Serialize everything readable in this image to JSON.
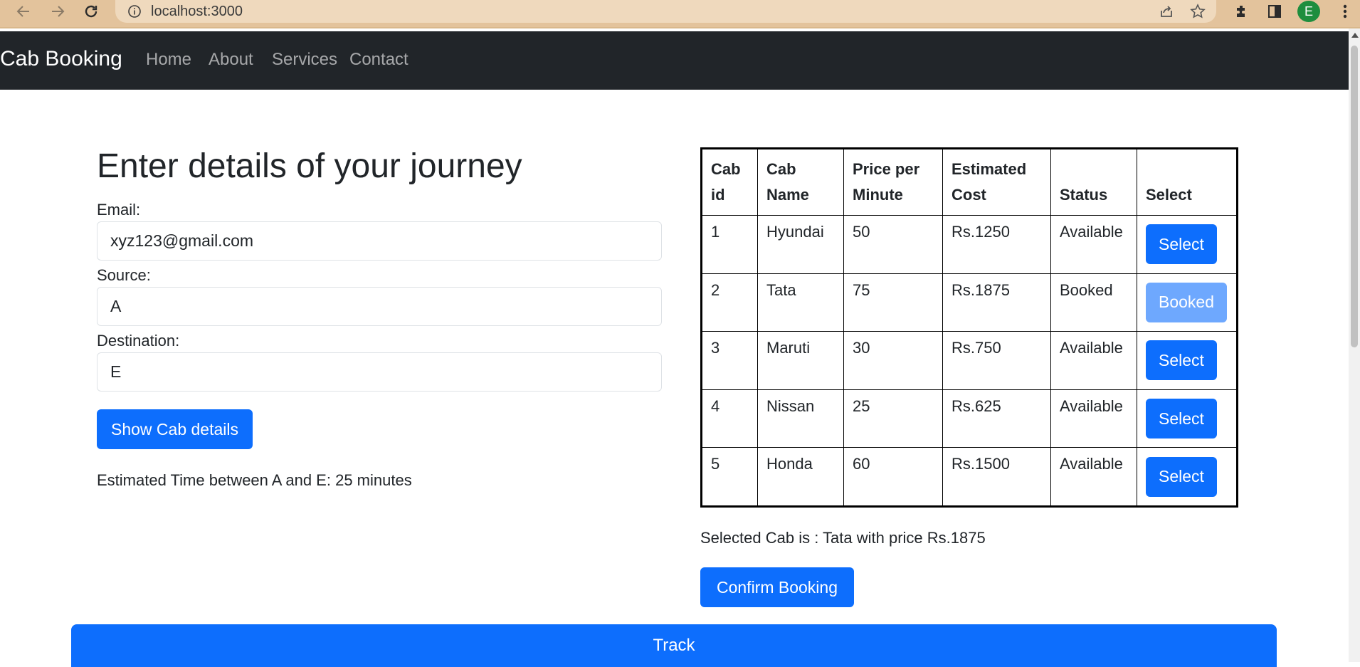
{
  "browser": {
    "url": "localhost:3000",
    "profile_initial": "E",
    "icons": [
      "back-arrow-icon",
      "forward-arrow-icon",
      "reload-icon",
      "info-icon",
      "share-icon",
      "star-icon",
      "extensions-icon",
      "sidepanel-icon",
      "menu-dots-icon"
    ]
  },
  "navbar": {
    "brand": "Cab Booking",
    "links": [
      "Home",
      "About",
      "Services",
      "Contact"
    ]
  },
  "form": {
    "heading": "Enter details of your journey",
    "email_label": "Email:",
    "email_value": "xyz123@gmail.com",
    "source_label": "Source:",
    "source_value": "A",
    "destination_label": "Destination:",
    "destination_value": "E",
    "show_button": "Show Cab details",
    "estimate_text": "Estimated Time between A and E: 25 minutes"
  },
  "table": {
    "headers": [
      [
        "Cab",
        "id"
      ],
      [
        "Cab",
        "Name"
      ],
      [
        "Price per",
        "Minute"
      ],
      [
        "Estimated",
        "Cost"
      ],
      [
        "Status"
      ],
      [
        "Select"
      ]
    ],
    "rows": [
      {
        "id": "1",
        "name": "Hyundai",
        "price": "50",
        "cost": "Rs.1250",
        "status": "Available",
        "action": "Select"
      },
      {
        "id": "2",
        "name": "Tata",
        "price": "75",
        "cost": "Rs.1875",
        "status": "Booked",
        "action": "Booked"
      },
      {
        "id": "3",
        "name": "Maruti",
        "price": "30",
        "cost": "Rs.750",
        "status": "Available",
        "action": "Select"
      },
      {
        "id": "4",
        "name": "Nissan",
        "price": "25",
        "cost": "Rs.625",
        "status": "Available",
        "action": "Select"
      },
      {
        "id": "5",
        "name": "Honda",
        "price": "60",
        "cost": "Rs.1500",
        "status": "Available",
        "action": "Select"
      }
    ]
  },
  "selection": {
    "text": "Selected Cab is : Tata with price Rs.1875",
    "confirm_button": "Confirm Booking"
  },
  "track_button": "Track",
  "colors": {
    "primary": "#0d6efd",
    "primary_disabled": "#6ea8fe",
    "navbar": "#212529",
    "browser_bar": "#e3c39c"
  }
}
